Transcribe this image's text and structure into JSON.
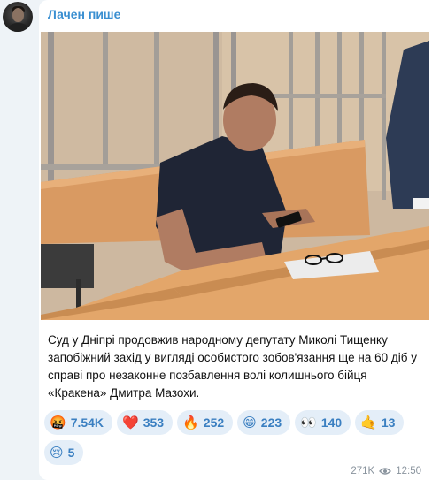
{
  "channel": {
    "name": "Лачен пише"
  },
  "photo": {
    "alt": ""
  },
  "caption": "Суд у Дніпрі продовжив народному депутату Миколі Тищенку запобіжний захід у вигляді особистого зобов'язання ще на 60 діб у справі про незаконне позбавлення волі колишнього бійця «Кракена» Дмитра Мазохи.",
  "reactions": [
    {
      "emoji": "🤬",
      "icon": "angry-face-icon",
      "count": "7.54K"
    },
    {
      "emoji": "❤️",
      "icon": "red-heart-icon",
      "count": "353"
    },
    {
      "emoji": "🔥",
      "icon": "fire-icon",
      "count": "252"
    },
    {
      "emoji": "😁",
      "icon": "grinning-face-icon",
      "count": "223"
    },
    {
      "emoji": "👀",
      "icon": "eyes-icon",
      "count": "140"
    },
    {
      "emoji": "🤙",
      "icon": "call-me-hand-icon",
      "count": "13"
    },
    {
      "emoji": "😢",
      "icon": "crying-face-icon",
      "count": "5"
    }
  ],
  "meta": {
    "views": "271K",
    "time": "12:50"
  },
  "colors": {
    "accent": "#3a8fd1",
    "reaction_bg": "#e4eef8",
    "background": "#eef3f7"
  }
}
